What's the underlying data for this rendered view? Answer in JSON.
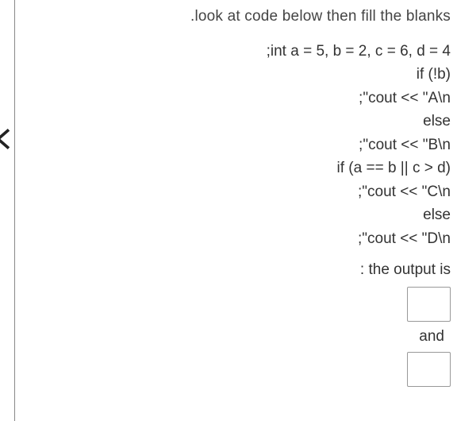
{
  "title": ".look at code below then fill the blanks",
  "code": {
    "line1": ";int a = 5, b = 2, c = 6, d = 4",
    "line2": "if (!b)",
    "line3": ";\"cout << \"A\\n",
    "line4": "else",
    "line5": ";\"cout << \"B\\n",
    "line6": "if (a == b || c > d)",
    "line7": ";\"cout << \"C\\n",
    "line8": "else",
    "line9": ";\"cout << \"D\\n"
  },
  "output_label": ": the output is",
  "and_label": "and",
  "blank1": "",
  "blank2": ""
}
